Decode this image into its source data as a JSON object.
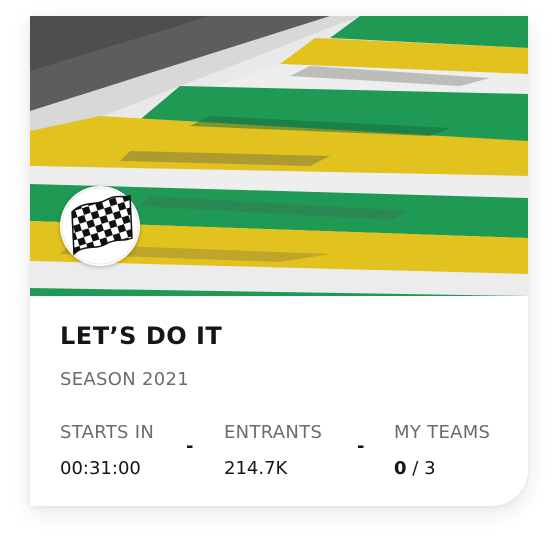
{
  "card": {
    "title": "LET’S DO IT",
    "season": "SEASON 2021",
    "badge_icon": "checkered-flag-icon",
    "stats": {
      "starts_in": {
        "label": "STARTS IN",
        "value": "00:31:00"
      },
      "entrants": {
        "label": "ENTRANTS",
        "value": "214.7K"
      },
      "my_teams": {
        "label": "MY TEAMS",
        "current": "0",
        "separator": "/",
        "total": "3"
      }
    },
    "separator_symbol": "-"
  },
  "colors": {
    "title": "#15151e",
    "muted": "#6b6b73",
    "kerb_green": "#1f9a55",
    "kerb_yellow": "#e2c21e",
    "kerb_white": "#eeeeee",
    "asphalt": "#5a5c5e"
  }
}
